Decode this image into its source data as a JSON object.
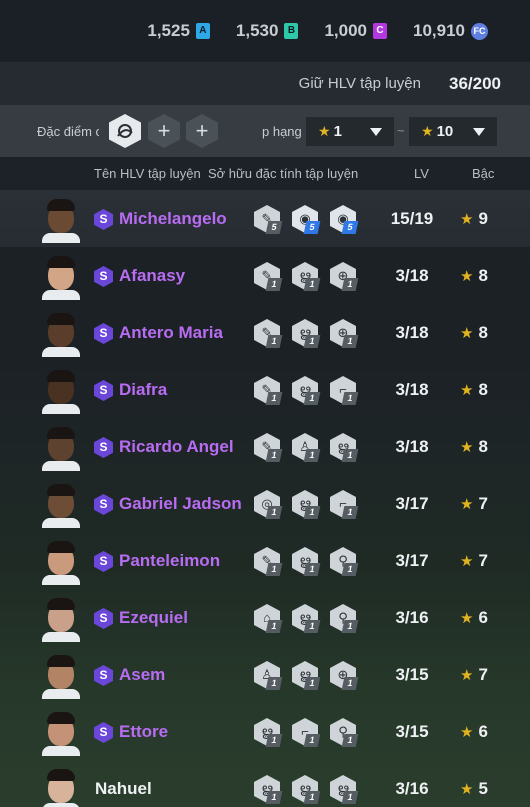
{
  "currencies": [
    {
      "value": "1,525",
      "icon": "A",
      "color": "#2fa8e8"
    },
    {
      "value": "1,530",
      "icon": "B",
      "color": "#2ec9a8"
    },
    {
      "value": "1,000",
      "icon": "C",
      "color": "#b338e0"
    },
    {
      "value": "10,910",
      "icon": "FC",
      "color": "#5f7fe0"
    }
  ],
  "hold": {
    "label": "Giữ HLV tập luyện",
    "count": "36/200"
  },
  "filter": {
    "trait_label": "Đặc điểm c",
    "add_symbol": "+",
    "rank_label": "p hạng",
    "rank_from": "1",
    "rank_to": "10",
    "tilde": "~"
  },
  "columns": {
    "name": "Tên HLV tập luyện",
    "traits": "Sở hữu đặc tính tập luyện",
    "lv": "LV",
    "grade": "Bậc"
  },
  "coaches": [
    {
      "name": "Michelangelo",
      "lv": "15/19",
      "grade": "9",
      "special": true,
      "trait_levels": [
        "5",
        "5",
        "5"
      ],
      "trait_icons": [
        "whistle-icon",
        "ball-swirl-icon",
        "ball-swirl-icon"
      ],
      "skin": "#6b4a33"
    },
    {
      "name": "Afanasy",
      "lv": "3/18",
      "grade": "8",
      "special": true,
      "trait_levels": [
        "1",
        "1",
        "1"
      ],
      "trait_icons": [
        "whistle-icon",
        "swirl-icon",
        "target-icon"
      ],
      "skin": "#d2a586"
    },
    {
      "name": "Antero Maria",
      "lv": "3/18",
      "grade": "8",
      "special": true,
      "trait_levels": [
        "1",
        "1",
        "1"
      ],
      "trait_icons": [
        "whistle-icon",
        "swirl-icon",
        "target-icon"
      ],
      "skin": "#5a3d2a"
    },
    {
      "name": "Diafra",
      "lv": "3/18",
      "grade": "8",
      "special": true,
      "trait_levels": [
        "1",
        "1",
        "1"
      ],
      "trait_icons": [
        "whistle-icon",
        "swirl-icon",
        "shoe-icon"
      ],
      "skin": "#4a3222"
    },
    {
      "name": "Ricardo Angel",
      "lv": "3/18",
      "grade": "8",
      "special": true,
      "trait_levels": [
        "1",
        "1",
        "1"
      ],
      "trait_icons": [
        "whistle-icon",
        "player-icon",
        "swirl-icon"
      ],
      "skin": "#5e4230"
    },
    {
      "name": "Gabriel Jadson",
      "lv": "3/17",
      "grade": "7",
      "special": true,
      "trait_levels": [
        "1",
        "1",
        "1"
      ],
      "trait_icons": [
        "eye-icon",
        "swirl-icon",
        "shoe-icon"
      ],
      "skin": "#6e4d37"
    },
    {
      "name": "Panteleimon",
      "lv": "3/17",
      "grade": "7",
      "special": true,
      "trait_levels": [
        "1",
        "1",
        "1"
      ],
      "trait_icons": [
        "whistle-icon",
        "swirl-icon",
        "runner-icon"
      ],
      "skin": "#c99a7c"
    },
    {
      "name": "Ezequiel",
      "lv": "3/16",
      "grade": "6",
      "special": true,
      "trait_levels": [
        "1",
        "1",
        "1"
      ],
      "trait_icons": [
        "goal-icon",
        "swirl-icon",
        "runner-icon"
      ],
      "skin": "#c9a089"
    },
    {
      "name": "Asem",
      "lv": "3/15",
      "grade": "7",
      "special": true,
      "trait_levels": [
        "1",
        "1",
        "1"
      ],
      "trait_icons": [
        "player-icon",
        "swirl-icon",
        "target-icon"
      ],
      "skin": "#b38366"
    },
    {
      "name": "Ettore",
      "lv": "3/15",
      "grade": "6",
      "special": true,
      "trait_levels": [
        "1",
        "1",
        "1"
      ],
      "trait_icons": [
        "swirl-icon",
        "shoe-icon",
        "runner-icon"
      ],
      "skin": "#c49277"
    },
    {
      "name": "Nahuel",
      "lv": "3/16",
      "grade": "5",
      "special": false,
      "trait_levels": [
        "1",
        "1",
        "1"
      ],
      "trait_icons": [
        "swirl-icon",
        "swirl-icon",
        "swirl-icon"
      ],
      "skin": "#d8b39b"
    }
  ]
}
